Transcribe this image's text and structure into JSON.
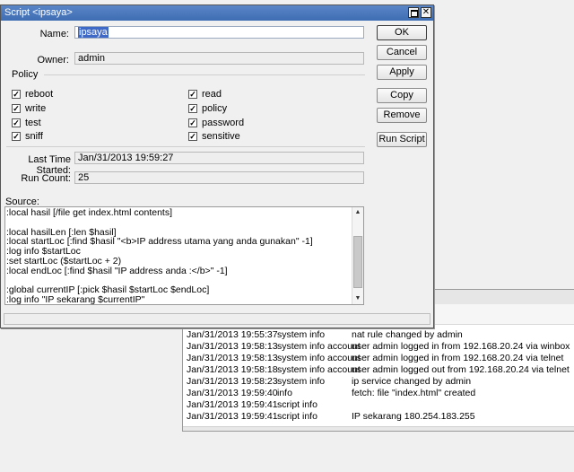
{
  "dialog": {
    "title": "Script <ipsaya>",
    "name_label": "Name:",
    "name_value": "ipsaya",
    "owner_label": "Owner:",
    "owner_value": "admin",
    "policy_label": "Policy",
    "policies": [
      {
        "label": "reboot",
        "checked": true
      },
      {
        "label": "read",
        "checked": true
      },
      {
        "label": "write",
        "checked": true
      },
      {
        "label": "policy",
        "checked": true
      },
      {
        "label": "test",
        "checked": true
      },
      {
        "label": "password",
        "checked": true
      },
      {
        "label": "sniff",
        "checked": true
      },
      {
        "label": "sensitive",
        "checked": true
      }
    ],
    "last_started_label": "Last Time Started:",
    "last_started_value": "Jan/31/2013 19:59:27",
    "run_count_label": "Run Count:",
    "run_count_value": "25",
    "source_label": "Source:",
    "source_lines": [
      ":local hasil [/file get index.html contents]",
      "",
      ":local hasilLen [:len $hasil]",
      ":local startLoc [:find $hasil \"<b>IP address utama yang anda gunakan\" -1]",
      ":log info $startLoc",
      ":set startLoc ($startLoc + 2)",
      ":local endLoc [:find $hasil \"IP address anda :</b>\" -1]",
      "",
      ":global currentIP [:pick $hasil $startLoc $endLoc]",
      ":log info \"IP sekarang $currentIP\""
    ],
    "buttons": {
      "ok": "OK",
      "cancel": "Cancel",
      "apply": "Apply",
      "copy": "Copy",
      "remove": "Remove",
      "run_script": "Run Script"
    },
    "close_glyph": "✕",
    "check_glyph": "✓"
  },
  "log": {
    "rows": [
      {
        "time": "Jan/31/2013 19:55:37",
        "topic": "system info",
        "message": "nat rule changed by admin"
      },
      {
        "time": "Jan/31/2013 19:58:13",
        "topic": "system info account",
        "message": "user admin logged in from 192.168.20.24 via winbox"
      },
      {
        "time": "Jan/31/2013 19:58:13",
        "topic": "system info account",
        "message": "user admin logged in from 192.168.20.24 via telnet"
      },
      {
        "time": "Jan/31/2013 19:58:18",
        "topic": "system info account",
        "message": "user admin logged out from 192.168.20.24 via telnet"
      },
      {
        "time": "Jan/31/2013 19:58:23",
        "topic": "system info",
        "message": "ip service changed by admin"
      },
      {
        "time": "Jan/31/2013 19:59:40",
        "topic": "info",
        "message": "fetch: file \"index.html\" created"
      },
      {
        "time": "Jan/31/2013 19:59:41",
        "topic": "script info",
        "message": ""
      },
      {
        "time": "Jan/31/2013 19:59:41",
        "topic": "script info",
        "message": "IP sekarang 180.254.183.255"
      }
    ]
  },
  "colors": {
    "titlebar": "#3f6db3",
    "selection": "#3e69c6",
    "background": "#f0f0f0"
  }
}
